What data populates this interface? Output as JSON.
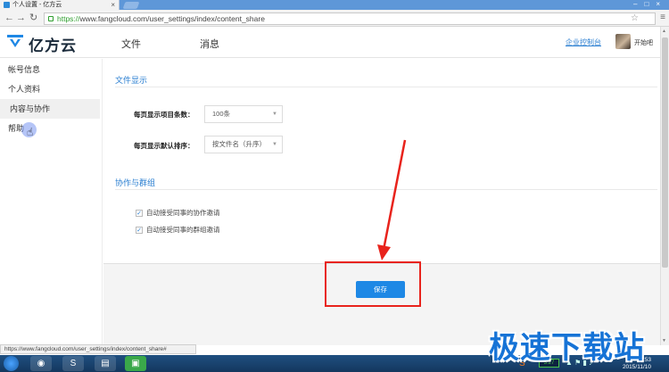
{
  "browser": {
    "tab_title": "个人设置 - 亿方云",
    "url_scheme": "https://",
    "url_rest": "www.fangcloud.com/user_settings/index/content_share"
  },
  "header": {
    "logo_text": "亿方云",
    "nav": [
      "文件",
      "消息"
    ],
    "console_link": "企业控制台",
    "username": "开始吧",
    "brand_color": "#1e88e5"
  },
  "sidebar": {
    "items": [
      {
        "label": "帐号信息"
      },
      {
        "label": "个人资料"
      },
      {
        "label": "内容与协作"
      },
      {
        "label": "帮助"
      }
    ]
  },
  "main": {
    "file_display": {
      "title": "文件显示",
      "per_page_label": "每页显示项目条数：",
      "per_page_value": "100条",
      "sort_label": "每页显示默认排序：",
      "sort_value": "按文件名（升序）"
    },
    "collab": {
      "title": "协作与群组",
      "options": [
        {
          "label": "自动接受同事的协作邀请",
          "checked": true
        },
        {
          "label": "自动接受同事的群组邀请",
          "checked": true
        }
      ]
    },
    "save_label": "保存"
  },
  "statusbar": {
    "text": "https://www.fangcloud.com/user_settings/index/content_share#"
  },
  "taskbar": {
    "battery": "3:27",
    "time": "14:53",
    "date": "2015/11/10"
  },
  "watermark": "极速下载站"
}
